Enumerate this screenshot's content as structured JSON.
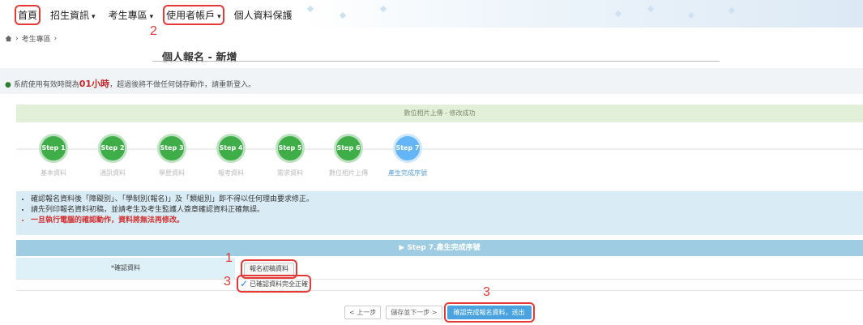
{
  "nav": {
    "home": "首頁",
    "items": [
      {
        "label": "招生資訊",
        "dropdown": true
      },
      {
        "label": "考生專區",
        "dropdown": true
      },
      {
        "label": "使用者帳戶",
        "dropdown": true
      },
      {
        "label": "個人資料保護",
        "dropdown": false
      }
    ]
  },
  "breadcrumb": {
    "item": "考生專區"
  },
  "page": {
    "title": "個人報名 - 新增"
  },
  "notice": {
    "prefix": "系統使用有效時間為",
    "time": "01小時",
    "suffix": "，超過後將不做任何儲存動作，請重新登入。"
  },
  "success_message": "數位相片上傳 - 修改成功",
  "steps": [
    {
      "badge": "Step 1",
      "label": "基本資料"
    },
    {
      "badge": "Step 2",
      "label": "通訊資料"
    },
    {
      "badge": "Step 3",
      "label": "學歷資料"
    },
    {
      "badge": "Step 4",
      "label": "報考資料"
    },
    {
      "badge": "Step 5",
      "label": "需求資料"
    },
    {
      "badge": "Step 6",
      "label": "數位相片上傳"
    },
    {
      "badge": "Step 7",
      "label": "產生完成序號"
    }
  ],
  "info": [
    "確認報名資料後「障礙別」、「學制別(報名)」及「類組別」即不得以任何理由要求修正。",
    "請先列印報名資料初稿，並請考生及考生監護人簽章確認資料正確無誤。",
    "一旦執行電腦的確認動作，資料將無法再修改。"
  ],
  "section": {
    "title": "Step 7.產生完成序號"
  },
  "form": {
    "confirm_label": "*確認資料",
    "draft_button": "報名初稿資料",
    "checkbox_label": "已確認資料完全正確"
  },
  "buttons": {
    "prev": "< 上一步",
    "save_next": "儲存並下一步 >",
    "submit": "確認完成報名資料，送出"
  },
  "annotations": {
    "n1": "1",
    "n2": "2",
    "n3a": "3",
    "n3b": "3"
  },
  "colors": {
    "step_green": "#3fae49",
    "step_active": "#64b5f6",
    "highlight": "#e53935",
    "section_blue": "#9ecde3"
  }
}
